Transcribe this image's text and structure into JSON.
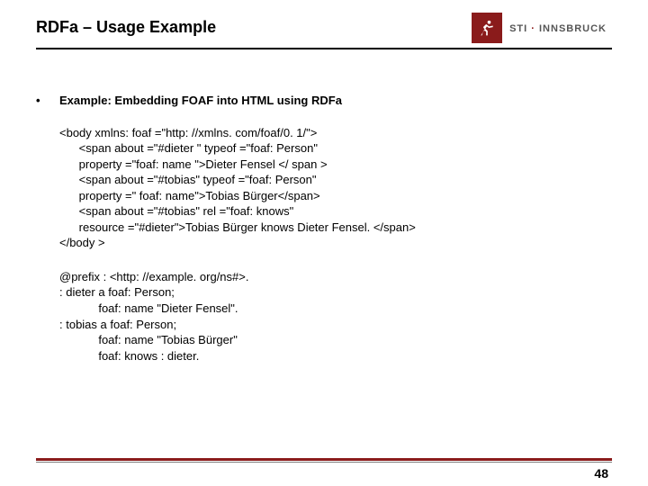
{
  "header": {
    "title": "RDFa – Usage Example",
    "logo": {
      "brand": "STI",
      "mid": " · ",
      "city": "INNSBRUCK"
    }
  },
  "bullet": {
    "label": "Example: Embedding FOAF into HTML using RDFa"
  },
  "code": "<body xmlns: foaf =\"http: //xmlns. com/foaf/0. 1/\">\n      <span about =\"#dieter \" typeof =\"foaf: Person\"\n      property =\"foaf: name \">Dieter Fensel </ span >\n      <span about =\"#tobias\" typeof =\"foaf: Person\"\n      property =\" foaf: name\">Tobias Bürger</span>\n      <span about =\"#tobias\" rel =\"foaf: knows\"\n      resource =\"#dieter\">Tobias Bürger knows Dieter Fensel. </span>\n</body >",
  "turtle": "@prefix : <http: //example. org/ns#>.\n: dieter a foaf: Person;\n            foaf: name \"Dieter Fensel\".\n: tobias a foaf: Person;\n            foaf: name \"Tobias Bürger\"\n            foaf: knows : dieter.",
  "page": "48"
}
